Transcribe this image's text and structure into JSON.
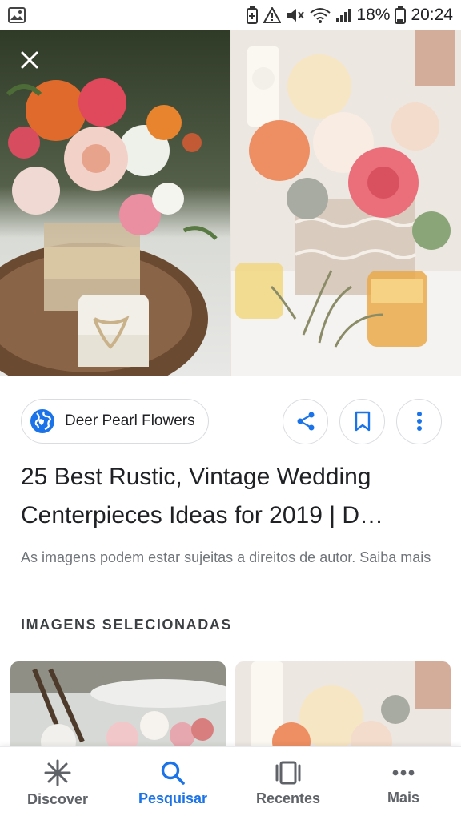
{
  "status_bar": {
    "left_icon": "gallery-notification-icon",
    "icons": [
      "battery-saver-icon",
      "alert-triangle-icon",
      "mute-icon",
      "wifi-icon",
      "signal-icon"
    ],
    "battery": "18%",
    "time": "20:24"
  },
  "hero": {
    "close_icon": "close-icon",
    "left_image": "rustic-flower-centerpiece-photo",
    "right_image": "lace-flower-centerpiece-photo"
  },
  "source": {
    "icon": "globe-icon",
    "name": "Deer Pearl Flowers"
  },
  "actions": [
    "share-icon",
    "bookmark-icon",
    "more-vert-icon"
  ],
  "title": "25 Best Rustic, Vintage Wedding Centerpieces Ideas for 2019 | D…",
  "copyright": "As imagens podem estar sujeitas a direitos de autor. Saiba mais",
  "section_heading": "IMAGENS SELECIONADAS",
  "bottom_nav": {
    "items": [
      {
        "label": "Discover",
        "icon": "asterisk-icon",
        "active": false
      },
      {
        "label": "Pesquisar",
        "icon": "search-icon",
        "active": true
      },
      {
        "label": "Recentes",
        "icon": "recents-icon",
        "active": false
      },
      {
        "label": "Mais",
        "icon": "more-horiz-icon",
        "active": false
      }
    ]
  },
  "colors": {
    "accent": "#1a73e8",
    "text": "#202124",
    "muted": "#70757a",
    "border": "#dadce0"
  }
}
